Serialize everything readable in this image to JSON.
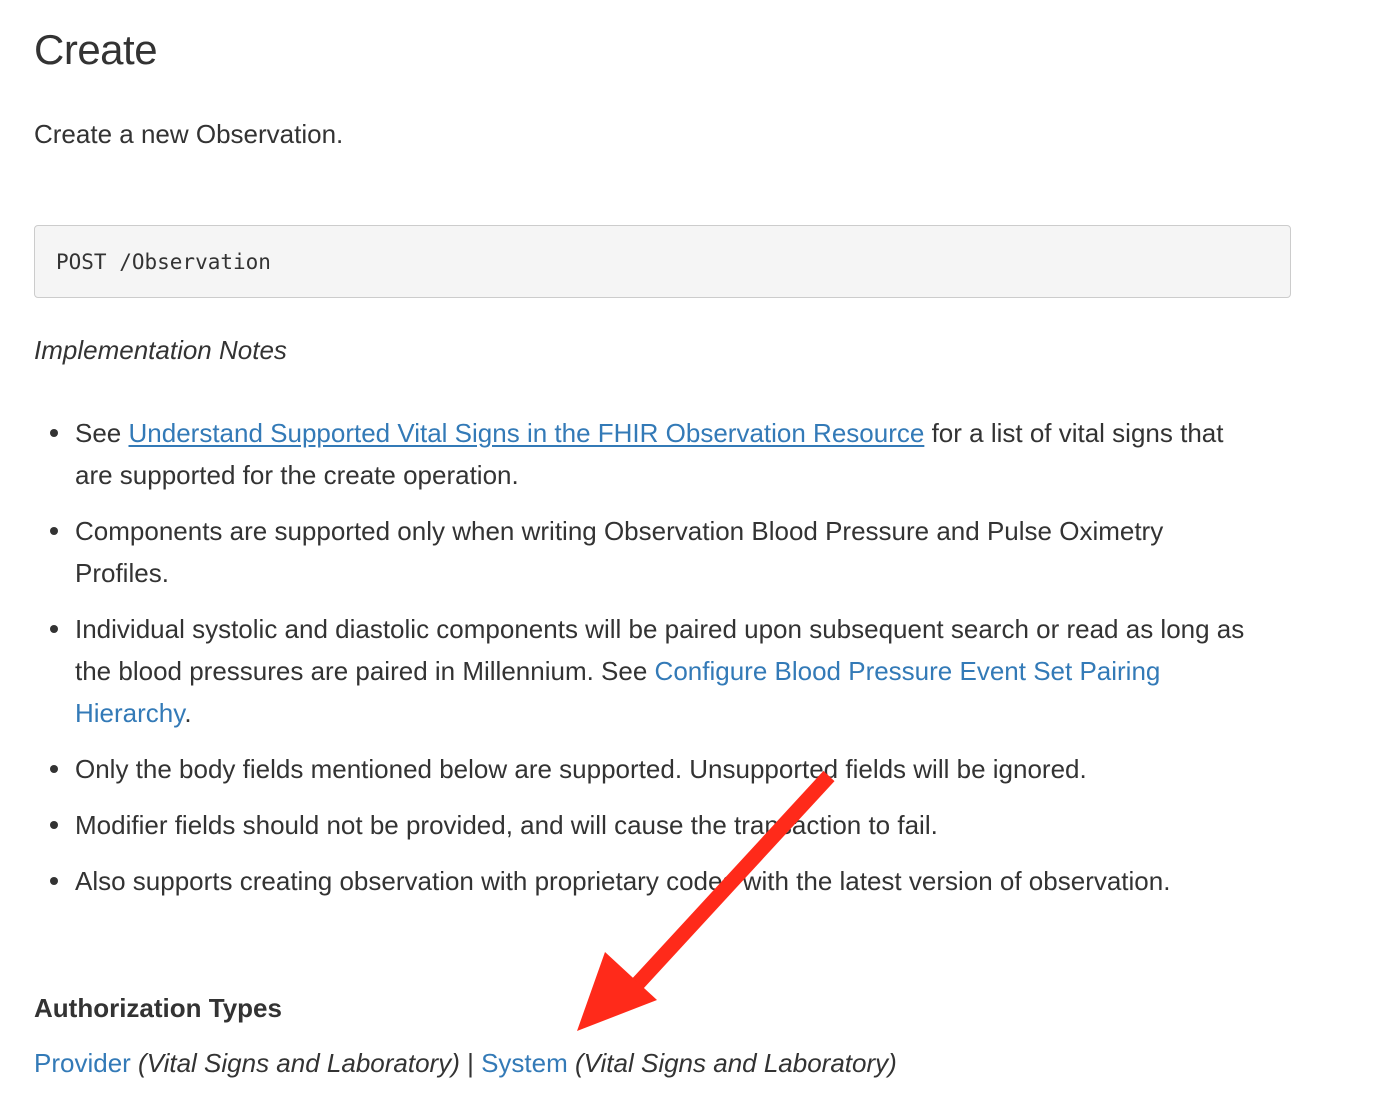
{
  "page": {
    "title": "Create",
    "intro": "Create a new Observation."
  },
  "endpoint": {
    "code": "POST /Observation"
  },
  "notes": {
    "heading": "Implementation Notes",
    "item1": {
      "prefix": "See ",
      "link": "Understand Supported Vital Signs in the FHIR Observation Resource",
      "suffix": " for a list of vital signs that are supported for the create operation."
    },
    "item2": "Components are supported only when writing Observation Blood Pressure and Pulse Oximetry Profiles.",
    "item3": {
      "prefix": "Individual systolic and diastolic components will be paired upon subsequent search or read as long as the blood pressures are paired in Millennium. See ",
      "link": "Configure Blood Pressure Event Set Pairing Hierarchy",
      "suffix": "."
    },
    "item4": "Only the body fields mentioned below are supported. Unsupported fields will be ignored.",
    "item5": "Modifier fields should not be provided, and will cause the transaction to fail.",
    "item6": "Also supports creating observation with proprietary codes with the latest version of observation."
  },
  "authorization": {
    "heading": "Authorization Types",
    "provider_link": "Provider",
    "provider_note": " (Vital Signs and Laboratory)",
    "separator": " | ",
    "system_link": "System",
    "system_note": " (Vital Signs and Laboratory)"
  },
  "annotation": {
    "arrow_color": "#ff2a1a"
  },
  "colors": {
    "text": "#333333",
    "link": "#337ab7",
    "code_bg": "#f5f5f5",
    "code_border": "#cccccc"
  }
}
